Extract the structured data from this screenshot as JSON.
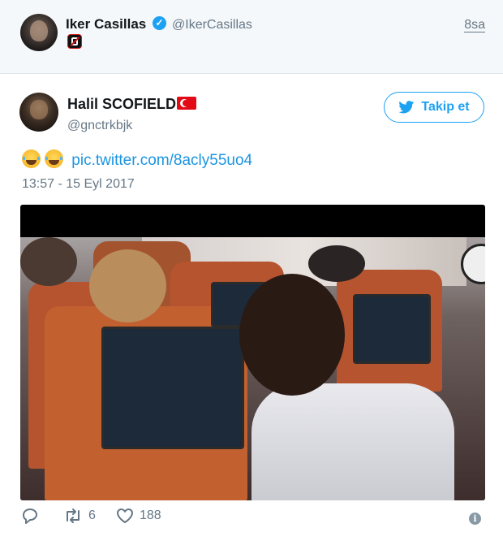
{
  "parent_tweet": {
    "name": "Iker Casillas",
    "handle": "@IkerCasillas",
    "time": "8sa",
    "verified_icon": "verified-badge-icon",
    "badge_icon": "no-phone-emoji-icon"
  },
  "tweet": {
    "name": "Halil SCOFIELD",
    "handle": "@gnctrkbjk",
    "flag_icon": "turkey-flag-emoji",
    "follow_label": "Takip et",
    "emoji": "face-with-tears-of-joy",
    "link": "pic.twitter.com/8acly55uo4",
    "date": "13:57 - 15 Eyl 2017",
    "media_icon": "video-player",
    "replies_icon": "reply-icon",
    "retweets": "6",
    "likes": "188",
    "info_icon": "info-icon"
  },
  "colors": {
    "accent": "#1da1f2",
    "link": "#1b95e0",
    "muted": "#657786",
    "top_bg": "#f5f8fa"
  }
}
